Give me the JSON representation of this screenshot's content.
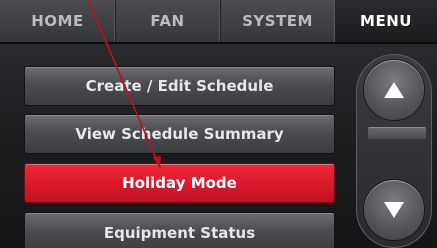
{
  "tabs": {
    "home": "HOME",
    "fan": "FAN",
    "system": "SYSTEM",
    "menu": "MENU"
  },
  "menu_items": [
    {
      "label": "Create / Edit Schedule",
      "selected": false
    },
    {
      "label": "View Schedule Summary",
      "selected": false
    },
    {
      "label": "Holiday Mode",
      "selected": true
    },
    {
      "label": "Equipment Status",
      "selected": false
    }
  ],
  "icons": {
    "scroll_up": "triangle-up-icon",
    "scroll_down": "triangle-down-icon"
  },
  "colors": {
    "selected": "#d8182a",
    "pointer": "#c0101e"
  }
}
